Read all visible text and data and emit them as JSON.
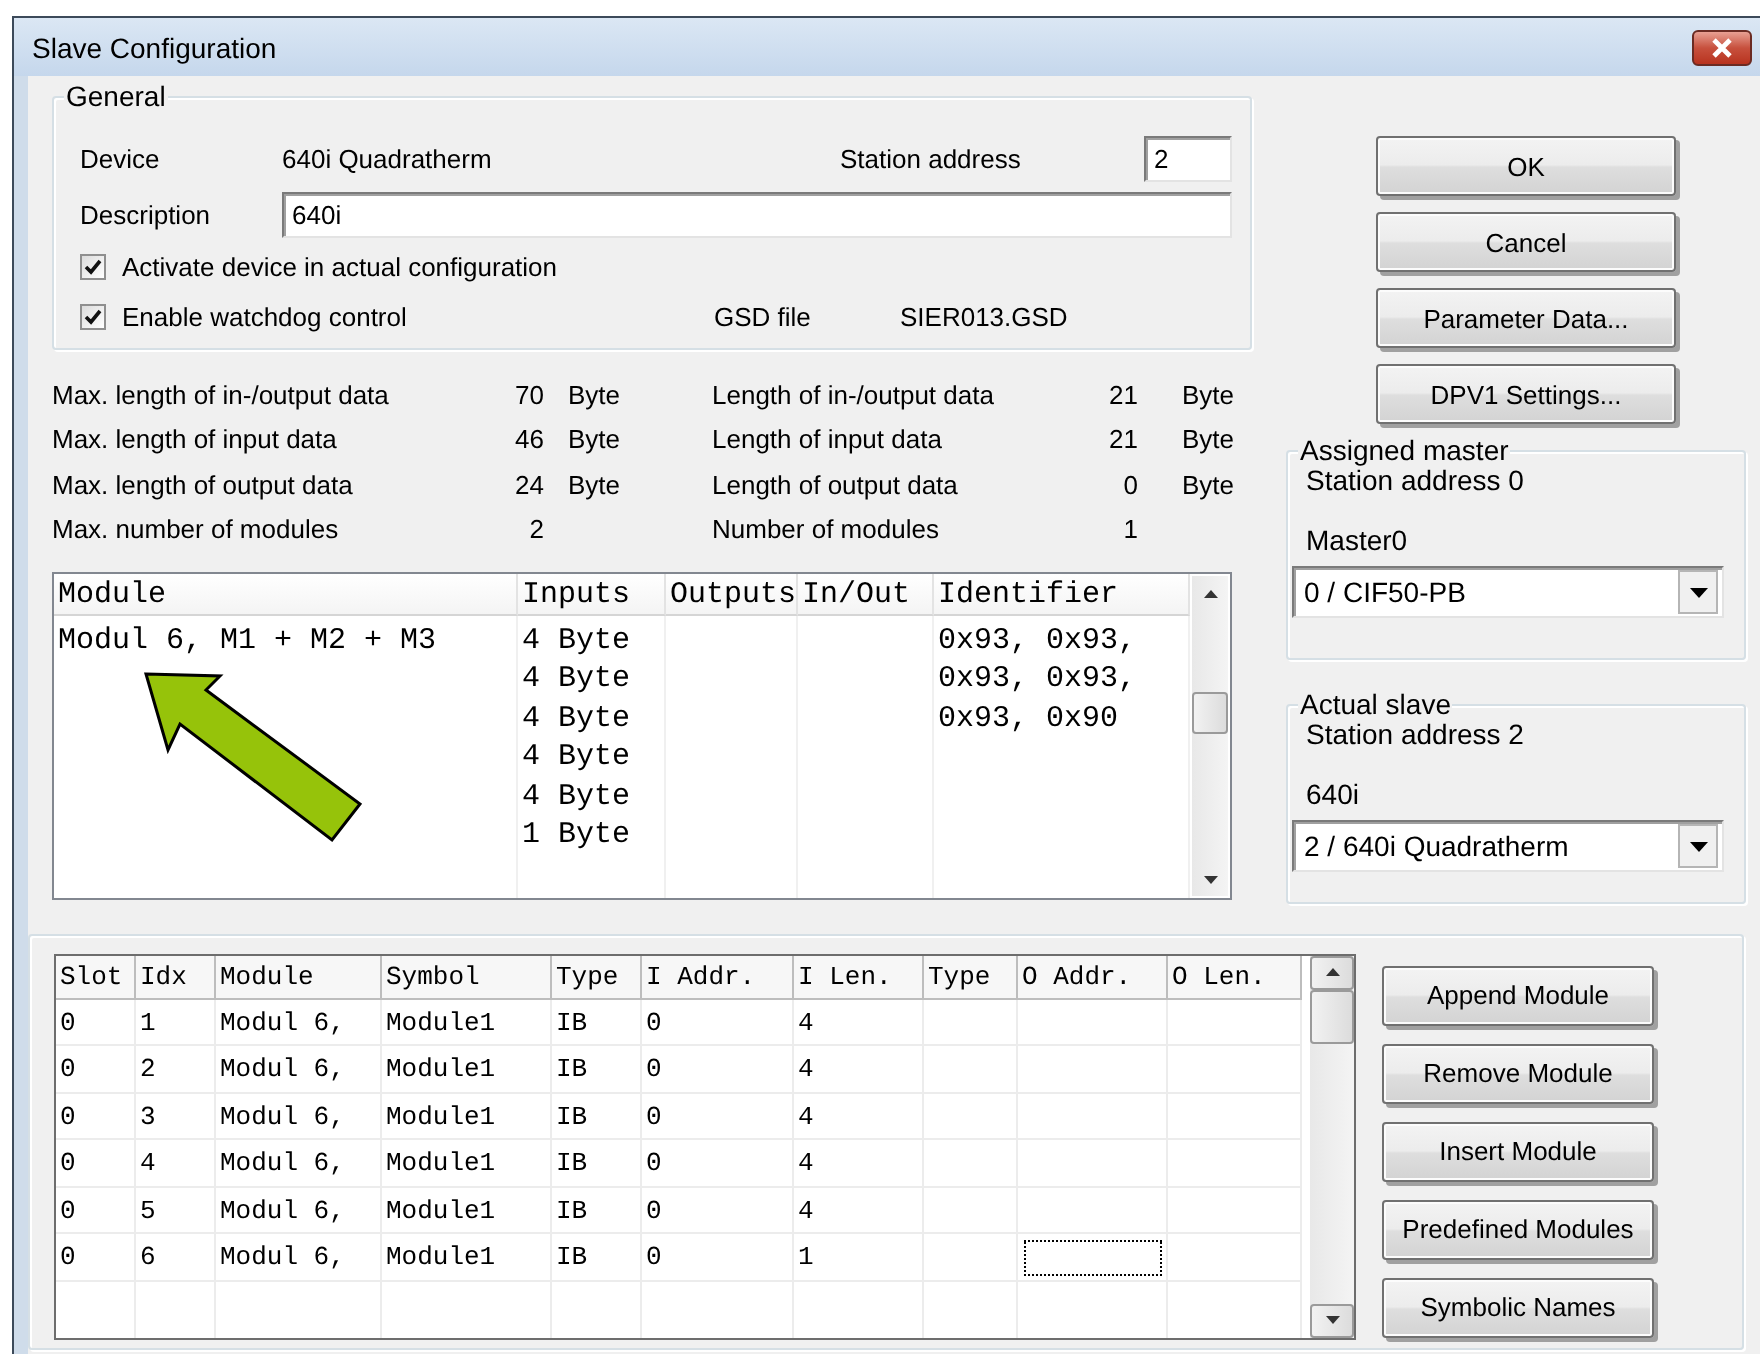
{
  "window": {
    "title": "Slave Configuration"
  },
  "general": {
    "legend": "General",
    "device_label": "Device",
    "device": "640i Quadratherm",
    "station_address_label": "Station address",
    "station_address": "2",
    "description_label": "Description",
    "description": "640i",
    "checkboxes": [
      {
        "label": "Activate device in actual configuration",
        "checked": true
      },
      {
        "label": "Enable watchdog control",
        "checked": true
      }
    ],
    "gsd_file_label": "GSD file",
    "gsd_file": "SIER013.GSD"
  },
  "lengths": [
    {
      "label": "Max. length of in-/output data",
      "value": "70",
      "unit": "Byte",
      "actual_label": "Length of in-/output data",
      "actual_value": "21",
      "actual_unit": "Byte"
    },
    {
      "label": "Max. length of input data",
      "value": "46",
      "unit": "Byte",
      "actual_label": "Length of input data",
      "actual_value": "21",
      "actual_unit": "Byte"
    },
    {
      "label": "Max. length of output data",
      "value": "24",
      "unit": "Byte",
      "actual_label": "Length of output data",
      "actual_value": "0",
      "actual_unit": "Byte"
    },
    {
      "label": "Max. number of modules",
      "value": "2",
      "actual_label": "Number of modules",
      "actual_value": "1"
    }
  ],
  "module_list": {
    "columns": [
      "Module",
      "Inputs",
      "Outputs",
      "In/Out",
      "Identifier"
    ],
    "rows": [
      {
        "module": "Modul 6, M1 + M2 + M3",
        "inputs": [
          "4 Byte",
          "4 Byte",
          "4 Byte",
          "4 Byte",
          "4 Byte",
          "1 Byte"
        ],
        "identifier": [
          "0x93, 0x93,",
          "0x93, 0x93,",
          "0x93, 0x90"
        ]
      }
    ]
  },
  "buttons": [
    "OK",
    "Cancel",
    "Parameter Data...",
    "DPV1 Settings..."
  ],
  "assigned_master": {
    "legend": "Assigned master",
    "station": "Station address 0",
    "name": "Master0",
    "selection": "0 / CIF50-PB"
  },
  "actual_slave": {
    "legend": "Actual slave",
    "station": "Station address 2",
    "name": "640i",
    "selection": "2 / 640i Quadratherm"
  },
  "slot_table": {
    "columns": [
      "Slot",
      "Idx",
      "Module",
      "Symbol",
      "Type",
      "I Addr.",
      "I Len.",
      "Type",
      "O Addr.",
      "O Len."
    ],
    "rows": [
      {
        "cells": [
          "0",
          "1",
          "Modul 6,",
          "Module1",
          "IB",
          "0",
          "4"
        ],
        "focused": false
      },
      {
        "cells": [
          "0",
          "2",
          "Modul 6,",
          "Module1",
          "IB",
          "0",
          "4"
        ],
        "focused": false
      },
      {
        "cells": [
          "0",
          "3",
          "Modul 6,",
          "Module1",
          "IB",
          "0",
          "4"
        ],
        "focused": false
      },
      {
        "cells": [
          "0",
          "4",
          "Modul 6,",
          "Module1",
          "IB",
          "0",
          "4"
        ],
        "focused": false
      },
      {
        "cells": [
          "0",
          "5",
          "Modul 6,",
          "Module1",
          "IB",
          "0",
          "4"
        ],
        "focused": false
      },
      {
        "cells": [
          "0",
          "6",
          "Modul 6,",
          "Module1",
          "IB",
          "0",
          "1"
        ],
        "focused": true
      }
    ]
  },
  "module_buttons": [
    "Append Module",
    "Remove Module",
    "Insert Module",
    "Predefined Modules",
    "Symbolic Names"
  ]
}
